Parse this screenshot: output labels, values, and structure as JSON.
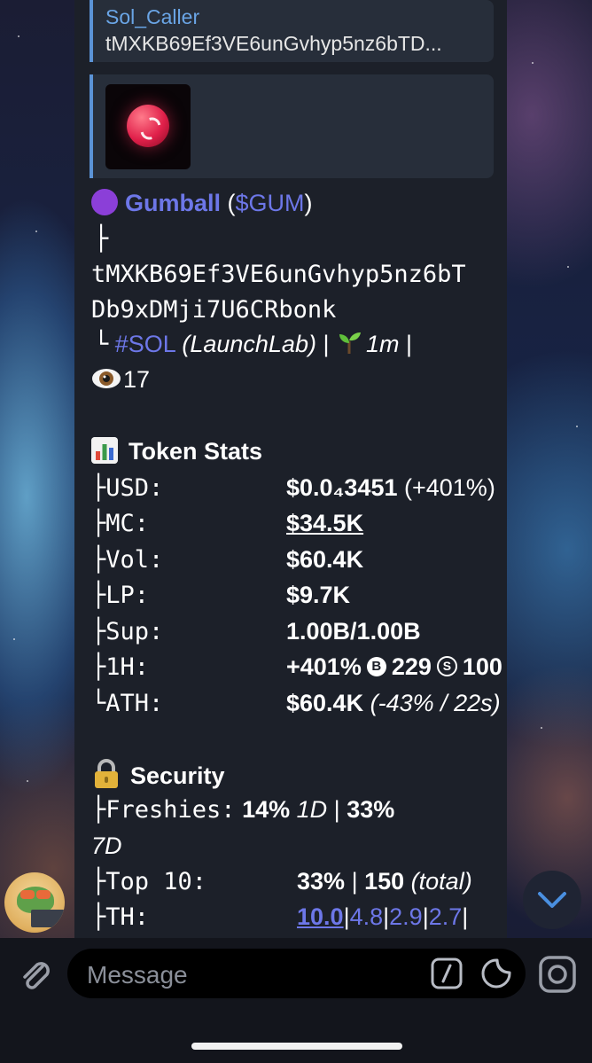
{
  "reply": {
    "name": "Sol_Caller",
    "text": "tMXKB69Ef3VE6unGvhyp5nz6bTD..."
  },
  "token": {
    "name": "Gumball",
    "paren_open": " (",
    "ticker": "$GUM",
    "paren_close": ")",
    "tree_first": "├",
    "address_line1": "tMXKB69Ef3VE6unGvhyp5nz6bT",
    "address_line2": "Db9xDMji7U6CRbonk",
    "tree_last": "└",
    "chain": "#SOL",
    "platform": "(LaunchLab)",
    "sep": "|",
    "age": "1m",
    "views": "17"
  },
  "token_stats": {
    "title": "Token Stats",
    "usd_label": "├USD:",
    "usd_value": "$0.0₄3451",
    "usd_change": "(+401%)",
    "mc_label": "├MC:",
    "mc_value": "$34.5K",
    "vol_label": "├Vol:",
    "vol_value": "$60.4K",
    "lp_label": "├LP:",
    "lp_value": "$9.7K",
    "sup_label": "├Sup:",
    "sup_value": "1.00B/1.00B",
    "h1_label": "├1H:",
    "h1_change": "+401%",
    "h1_buy_icon": "B",
    "h1_buys": "229",
    "h1_sell_icon": "S",
    "h1_sells": "100",
    "ath_label": "└ATH:",
    "ath_value": "$60.4K",
    "ath_detail": "(-43% / 22s)"
  },
  "security": {
    "title": "Security",
    "freshies_label": "├Freshies:",
    "freshies_1d": "14%",
    "freshies_1d_unit": "1D",
    "sep": "|",
    "freshies_7d": "33%",
    "freshies_7d_unit": "7D",
    "top10_label": "├Top 10:",
    "top10_pct": "33%",
    "top10_total": "150",
    "top10_total_label": "(total)",
    "th_label": "├TH:",
    "th_values": [
      "10.0",
      "4.8",
      "2.9",
      "2.7"
    ]
  },
  "composer": {
    "placeholder": "Message"
  },
  "icons": {
    "token_bullet": "purple-circle-icon",
    "stats": "bar-chart-icon",
    "security": "lock-icon",
    "views": "eye-icon",
    "age": "seedling-icon"
  }
}
